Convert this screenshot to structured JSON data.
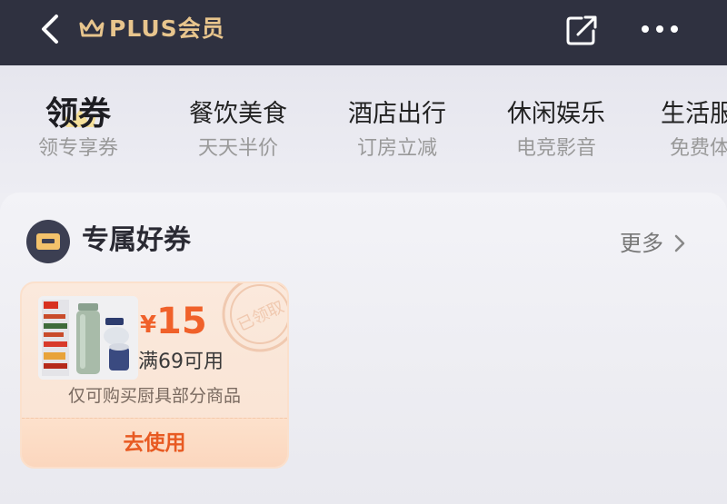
{
  "nav": {
    "title": "PLUS会员",
    "icons": [
      "chevron-left-icon",
      "crown-icon",
      "share-icon",
      "more-icon"
    ],
    "background": "#2f3140",
    "title_color": "#e8c58d"
  },
  "tabs": [
    {
      "title": "领券",
      "subtitle": "领专享券",
      "active": true
    },
    {
      "title": "餐饮美食",
      "subtitle": "天天半价",
      "active": false
    },
    {
      "title": "酒店出行",
      "subtitle": "订房立减",
      "active": false
    },
    {
      "title": "休闲娱乐",
      "subtitle": "电竞影音",
      "active": false
    },
    {
      "title": "生活服",
      "subtitle": "免费体",
      "active": false
    }
  ],
  "section": {
    "title": "专属好券",
    "more_label": "更多",
    "icon": "ticket-icon"
  },
  "coupon": {
    "price_symbol": "¥",
    "price_value": "15",
    "condition": "满69可用",
    "description": "仅可购买厨具部分商品",
    "button_label": "去使用",
    "stamp_text": "已领取",
    "accent_color": "#f0612a"
  }
}
